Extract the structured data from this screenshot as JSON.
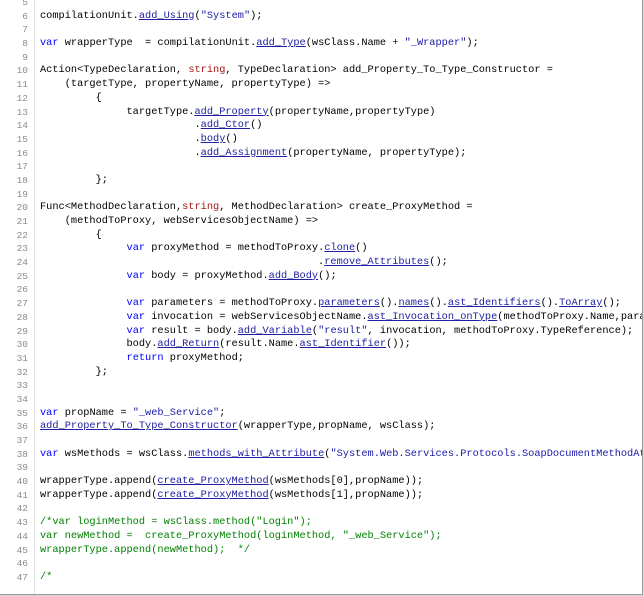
{
  "editor": {
    "lines": [
      {
        "num": "5",
        "tokens": []
      },
      {
        "num": "6",
        "tokens": [
          {
            "t": "compilationUnit.",
            "c": "plain"
          },
          {
            "t": "add_Using",
            "c": "blue"
          },
          {
            "t": "(",
            "c": "plain"
          },
          {
            "t": "\"System\"",
            "c": "str"
          },
          {
            "t": ");",
            "c": "plain"
          }
        ]
      },
      {
        "num": "7",
        "tokens": []
      },
      {
        "num": "8",
        "tokens": [
          {
            "t": "var",
            "c": "kw"
          },
          {
            "t": " wrapperType  = compilationUnit.",
            "c": "plain"
          },
          {
            "t": "add_Type",
            "c": "blue"
          },
          {
            "t": "(wsClass.Name + ",
            "c": "plain"
          },
          {
            "t": "\"_Wrapper\"",
            "c": "str"
          },
          {
            "t": ");",
            "c": "plain"
          }
        ]
      },
      {
        "num": "9",
        "tokens": []
      },
      {
        "num": "10",
        "tokens": [
          {
            "t": "Action<TypeDeclaration, ",
            "c": "plain"
          },
          {
            "t": "string",
            "c": "key"
          },
          {
            "t": ", TypeDeclaration> add_Property_To_Type_Constructor =",
            "c": "plain"
          }
        ]
      },
      {
        "num": "11",
        "tokens": [
          {
            "t": "    (targetType, propertyName, propertyType) =>",
            "c": "plain"
          }
        ]
      },
      {
        "num": "12",
        "tokens": [
          {
            "t": "         {",
            "c": "plain"
          }
        ]
      },
      {
        "num": "13",
        "tokens": [
          {
            "t": "              targetType.",
            "c": "plain"
          },
          {
            "t": "add_Property",
            "c": "blue"
          },
          {
            "t": "(propertyName,propertyType)",
            "c": "plain"
          }
        ]
      },
      {
        "num": "14",
        "tokens": [
          {
            "t": "                         .",
            "c": "plain"
          },
          {
            "t": "add_Ctor",
            "c": "blue"
          },
          {
            "t": "()",
            "c": "plain"
          }
        ]
      },
      {
        "num": "15",
        "tokens": [
          {
            "t": "                         .",
            "c": "plain"
          },
          {
            "t": "body",
            "c": "blue"
          },
          {
            "t": "()",
            "c": "plain"
          }
        ]
      },
      {
        "num": "16",
        "tokens": [
          {
            "t": "                         .",
            "c": "plain"
          },
          {
            "t": "add_Assignment",
            "c": "blue"
          },
          {
            "t": "(propertyName, propertyType);",
            "c": "plain"
          }
        ]
      },
      {
        "num": "17",
        "tokens": []
      },
      {
        "num": "18",
        "tokens": [
          {
            "t": "         };",
            "c": "plain"
          }
        ]
      },
      {
        "num": "19",
        "tokens": []
      },
      {
        "num": "20",
        "tokens": [
          {
            "t": "Func<MethodDeclaration,",
            "c": "plain"
          },
          {
            "t": "string",
            "c": "key"
          },
          {
            "t": ", MethodDeclaration> create_ProxyMethod =",
            "c": "plain"
          }
        ]
      },
      {
        "num": "21",
        "tokens": [
          {
            "t": "    (methodToProxy, webServicesObjectName) =>",
            "c": "plain"
          }
        ]
      },
      {
        "num": "22",
        "tokens": [
          {
            "t": "         {",
            "c": "plain"
          }
        ]
      },
      {
        "num": "23",
        "tokens": [
          {
            "t": "              ",
            "c": "plain"
          },
          {
            "t": "var",
            "c": "kw"
          },
          {
            "t": " proxyMethod = methodToProxy.",
            "c": "plain"
          },
          {
            "t": "clone",
            "c": "blue"
          },
          {
            "t": "()",
            "c": "plain"
          }
        ]
      },
      {
        "num": "24",
        "tokens": [
          {
            "t": "                                             .",
            "c": "plain"
          },
          {
            "t": "remove_Attributes",
            "c": "blue"
          },
          {
            "t": "();",
            "c": "plain"
          }
        ]
      },
      {
        "num": "25",
        "tokens": [
          {
            "t": "              ",
            "c": "plain"
          },
          {
            "t": "var",
            "c": "kw"
          },
          {
            "t": " body = proxyMethod.",
            "c": "plain"
          },
          {
            "t": "add_Body",
            "c": "blue"
          },
          {
            "t": "();",
            "c": "plain"
          }
        ]
      },
      {
        "num": "26",
        "tokens": []
      },
      {
        "num": "27",
        "tokens": [
          {
            "t": "              ",
            "c": "plain"
          },
          {
            "t": "var",
            "c": "kw"
          },
          {
            "t": " parameters = methodToProxy.",
            "c": "plain"
          },
          {
            "t": "parameters",
            "c": "blue"
          },
          {
            "t": "().",
            "c": "plain"
          },
          {
            "t": "names",
            "c": "blue"
          },
          {
            "t": "().",
            "c": "plain"
          },
          {
            "t": "ast_Identifiers",
            "c": "blue"
          },
          {
            "t": "().",
            "c": "plain"
          },
          {
            "t": "ToArray",
            "c": "blue"
          },
          {
            "t": "();",
            "c": "plain"
          }
        ]
      },
      {
        "num": "28",
        "tokens": [
          {
            "t": "              ",
            "c": "plain"
          },
          {
            "t": "var",
            "c": "kw"
          },
          {
            "t": " invocation = webServicesObjectName.",
            "c": "plain"
          },
          {
            "t": "ast_Invocation_onType",
            "c": "blue"
          },
          {
            "t": "(methodToProxy.Name,paramet",
            "c": "plain"
          }
        ]
      },
      {
        "num": "29",
        "tokens": [
          {
            "t": "              ",
            "c": "plain"
          },
          {
            "t": "var",
            "c": "kw"
          },
          {
            "t": " result = body.",
            "c": "plain"
          },
          {
            "t": "add_Variable",
            "c": "blue"
          },
          {
            "t": "(",
            "c": "plain"
          },
          {
            "t": "\"result\"",
            "c": "str"
          },
          {
            "t": ", invocation, methodToProxy.TypeReference);",
            "c": "plain"
          }
        ]
      },
      {
        "num": "30",
        "tokens": [
          {
            "t": "              body.",
            "c": "plain"
          },
          {
            "t": "add_Return",
            "c": "blue"
          },
          {
            "t": "(result.Name.",
            "c": "plain"
          },
          {
            "t": "ast_Identifier",
            "c": "blue"
          },
          {
            "t": "());",
            "c": "plain"
          }
        ]
      },
      {
        "num": "31",
        "tokens": [
          {
            "t": "              ",
            "c": "plain"
          },
          {
            "t": "return",
            "c": "kw"
          },
          {
            "t": " proxyMethod;",
            "c": "plain"
          }
        ]
      },
      {
        "num": "32",
        "tokens": [
          {
            "t": "         };",
            "c": "plain"
          }
        ]
      },
      {
        "num": "33",
        "tokens": []
      },
      {
        "num": "34",
        "tokens": []
      },
      {
        "num": "35",
        "tokens": [
          {
            "t": "var",
            "c": "kw"
          },
          {
            "t": " propName = ",
            "c": "plain"
          },
          {
            "t": "\"_web_Service\"",
            "c": "str"
          },
          {
            "t": ";",
            "c": "plain"
          }
        ]
      },
      {
        "num": "36",
        "tokens": [
          {
            "t": "add_Property_To_Type_Constructor",
            "c": "blue"
          },
          {
            "t": "(wrapperType,propName, wsClass);",
            "c": "plain"
          }
        ]
      },
      {
        "num": "37",
        "tokens": []
      },
      {
        "num": "38",
        "tokens": [
          {
            "t": "var",
            "c": "kw"
          },
          {
            "t": " wsMethods = wsClass.",
            "c": "plain"
          },
          {
            "t": "methods_with_Attribute",
            "c": "blue"
          },
          {
            "t": "(",
            "c": "plain"
          },
          {
            "t": "\"System.Web.Services.Protocols.SoapDocumentMethodAtt",
            "c": "str"
          }
        ]
      },
      {
        "num": "39",
        "tokens": []
      },
      {
        "num": "40",
        "tokens": [
          {
            "t": "wrapperType.append(",
            "c": "plain"
          },
          {
            "t": "create_ProxyMethod",
            "c": "blue"
          },
          {
            "t": "(wsMethods[0],propName));",
            "c": "plain"
          }
        ]
      },
      {
        "num": "41",
        "tokens": [
          {
            "t": "wrapperType.append(",
            "c": "plain"
          },
          {
            "t": "create_ProxyMethod",
            "c": "blue"
          },
          {
            "t": "(wsMethods[1],propName));",
            "c": "plain"
          }
        ]
      },
      {
        "num": "42",
        "tokens": []
      },
      {
        "num": "43",
        "tokens": [
          {
            "t": "/*var loginMethod = wsClass.method(\"Login\");",
            "c": "cmt"
          }
        ]
      },
      {
        "num": "44",
        "tokens": [
          {
            "t": "var newMethod =  create_ProxyMethod(loginMethod, \"_web_Service\");",
            "c": "cmt"
          }
        ]
      },
      {
        "num": "45",
        "tokens": [
          {
            "t": "wrapperType.append(newMethod);  */",
            "c": "cmt"
          }
        ]
      },
      {
        "num": "46",
        "tokens": []
      },
      {
        "num": "47",
        "tokens": [
          {
            "t": "/*",
            "c": "cmt"
          }
        ]
      }
    ]
  }
}
